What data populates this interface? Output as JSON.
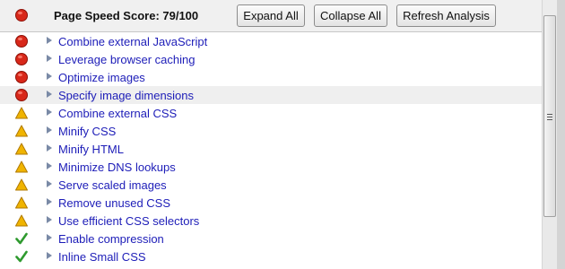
{
  "header": {
    "score_label": "Page Speed Score: 79/100",
    "score_status": "error",
    "buttons": {
      "expand": "Expand All",
      "collapse": "Collapse All",
      "refresh": "Refresh Analysis"
    }
  },
  "colors": {
    "error": "#d8281a",
    "warning": "#f0b400",
    "pass": "#2f9a2f",
    "link": "#1d1db8",
    "highlight_row": "#efefef"
  },
  "rules": [
    {
      "label": "Combine external JavaScript",
      "status": "error",
      "icon": "red-circle-icon"
    },
    {
      "label": "Leverage browser caching",
      "status": "error",
      "icon": "red-circle-icon"
    },
    {
      "label": "Optimize images",
      "status": "error",
      "icon": "red-circle-icon"
    },
    {
      "label": "Specify image dimensions",
      "status": "error",
      "icon": "red-circle-icon",
      "highlighted": true
    },
    {
      "label": "Combine external CSS",
      "status": "warning",
      "icon": "warning-triangle-icon"
    },
    {
      "label": "Minify CSS",
      "status": "warning",
      "icon": "warning-triangle-icon"
    },
    {
      "label": "Minify HTML",
      "status": "warning",
      "icon": "warning-triangle-icon"
    },
    {
      "label": "Minimize DNS lookups",
      "status": "warning",
      "icon": "warning-triangle-icon"
    },
    {
      "label": "Serve scaled images",
      "status": "warning",
      "icon": "warning-triangle-icon"
    },
    {
      "label": "Remove unused CSS",
      "status": "warning",
      "icon": "warning-triangle-icon"
    },
    {
      "label": "Use efficient CSS selectors",
      "status": "warning",
      "icon": "warning-triangle-icon"
    },
    {
      "label": "Enable compression",
      "status": "pass",
      "icon": "green-check-icon"
    },
    {
      "label": "Inline Small CSS",
      "status": "pass",
      "icon": "green-check-icon"
    }
  ]
}
